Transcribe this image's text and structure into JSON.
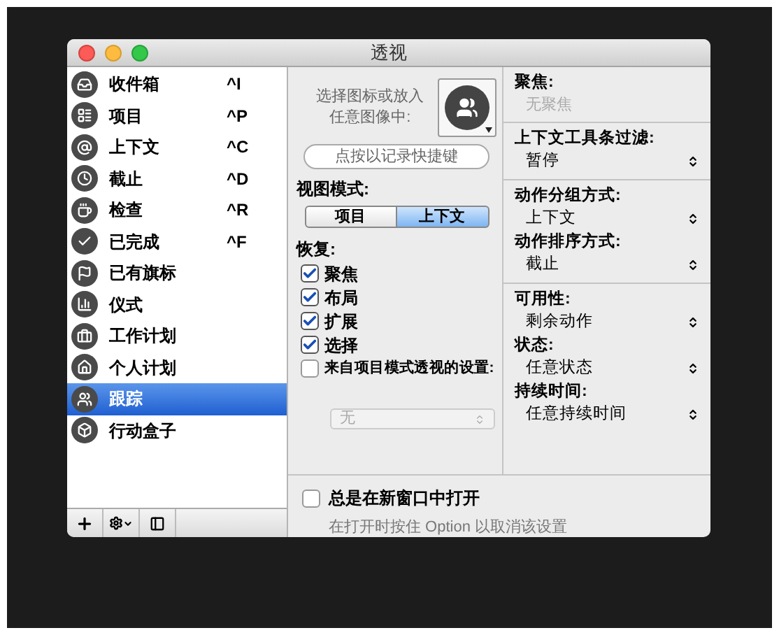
{
  "window": {
    "title": "透视"
  },
  "sidebar": {
    "items": [
      {
        "label": "收件箱",
        "shortcut": "^I",
        "selected": false
      },
      {
        "label": "项目",
        "shortcut": "^P",
        "selected": false
      },
      {
        "label": "上下文",
        "shortcut": "^C",
        "selected": false
      },
      {
        "label": "截止",
        "shortcut": "^D",
        "selected": false
      },
      {
        "label": "检查",
        "shortcut": "^R",
        "selected": false
      },
      {
        "label": "已完成",
        "shortcut": "^F",
        "selected": false
      },
      {
        "label": "已有旗标",
        "selected": false
      },
      {
        "label": "仪式",
        "selected": false
      },
      {
        "label": "工作计划",
        "selected": false
      },
      {
        "label": "个人计划",
        "selected": false
      },
      {
        "label": "跟踪",
        "selected": true
      },
      {
        "label": "行动盒子",
        "selected": false
      }
    ]
  },
  "detail": {
    "icon_picker": {
      "lines": [
        "选择图标或放入",
        "任意图像中:"
      ]
    },
    "shortcut_button": "点按以记录快捷键",
    "view_mode": {
      "label": "视图模式:",
      "segments": [
        {
          "label": "项目",
          "selected": false
        },
        {
          "label": "上下文",
          "selected": true
        }
      ]
    },
    "restore": {
      "label": "恢复:",
      "options": [
        {
          "label": "聚焦",
          "checked": true
        },
        {
          "label": "布局",
          "checked": true
        },
        {
          "label": "扩展",
          "checked": true
        },
        {
          "label": "选择",
          "checked": true
        }
      ]
    },
    "project_settings": {
      "label": "来自项目模式透视的设置:",
      "checked": false
    },
    "source_select": {
      "value": "无",
      "disabled": true
    }
  },
  "options": {
    "sections": [
      {
        "fields": [
          {
            "kind": "static",
            "label": "聚焦:",
            "value": "无聚焦"
          }
        ]
      },
      {
        "fields": [
          {
            "kind": "select",
            "label": "上下文工具条过滤:",
            "value": "暂停"
          }
        ]
      },
      {
        "fields": [
          {
            "kind": "select",
            "label": "动作分组方式:",
            "value": "上下文"
          },
          {
            "kind": "select",
            "label": "动作排序方式:",
            "value": "截止"
          }
        ]
      },
      {
        "fields": [
          {
            "kind": "select",
            "label": "可用性:",
            "value": "剩余动作"
          },
          {
            "kind": "select",
            "label": "状态:",
            "value": "任意状态"
          },
          {
            "kind": "select",
            "label": "持续时间:",
            "value": "任意持续时间"
          }
        ]
      }
    ]
  },
  "footer": {
    "open_in_new_window": {
      "label": "总是在新窗口中打开",
      "checked": false
    },
    "hint": "在打开时按住 Option 以取消该设置"
  }
}
